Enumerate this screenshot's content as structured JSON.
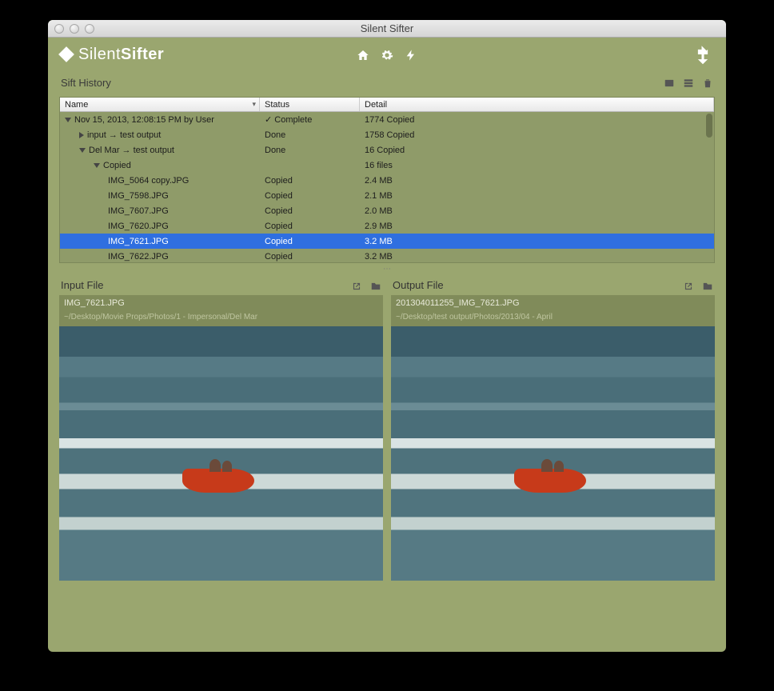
{
  "window": {
    "title": "Silent Sifter"
  },
  "app": {
    "name_light": "Silent",
    "name_bold": "Sifter"
  },
  "section": {
    "title": "Sift History"
  },
  "table": {
    "headers": {
      "name": "Name",
      "status": "Status",
      "detail": "Detail"
    },
    "rows": [
      {
        "indent": 0,
        "expander": "down",
        "name": "Nov 15, 2013, 12:08:15 PM by User",
        "status": "✓ Complete",
        "detail": "1774 Copied"
      },
      {
        "indent": 1,
        "expander": "right",
        "name": "input → test output",
        "status": "Done",
        "detail": "1758 Copied"
      },
      {
        "indent": 1,
        "expander": "down",
        "name": "Del Mar → test output",
        "status": "Done",
        "detail": "16 Copied"
      },
      {
        "indent": 2,
        "expander": "down",
        "name": "Copied",
        "status": "",
        "detail": "16 files"
      },
      {
        "indent": 3,
        "expander": "",
        "name": "IMG_5064 copy.JPG",
        "status": "Copied",
        "detail": "2.4 MB"
      },
      {
        "indent": 3,
        "expander": "",
        "name": "IMG_7598.JPG",
        "status": "Copied",
        "detail": "2.1 MB"
      },
      {
        "indent": 3,
        "expander": "",
        "name": "IMG_7607.JPG",
        "status": "Copied",
        "detail": "2.0 MB"
      },
      {
        "indent": 3,
        "expander": "",
        "name": "IMG_7620.JPG",
        "status": "Copied",
        "detail": "2.9 MB"
      },
      {
        "indent": 3,
        "expander": "",
        "name": "IMG_7621.JPG",
        "status": "Copied",
        "detail": "3.2 MB",
        "selected": true
      },
      {
        "indent": 3,
        "expander": "",
        "name": "IMG_7622.JPG",
        "status": "Copied",
        "detail": "3.2 MB"
      }
    ]
  },
  "input_file": {
    "label": "Input File",
    "name": "IMG_7621.JPG",
    "path": "~/Desktop/Movie Props/Photos/1 - Impersonal/Del Mar"
  },
  "output_file": {
    "label": "Output File",
    "name": "201304011255_IMG_7621.JPG",
    "path": "~/Desktop/test output/Photos/2013/04 - April"
  }
}
